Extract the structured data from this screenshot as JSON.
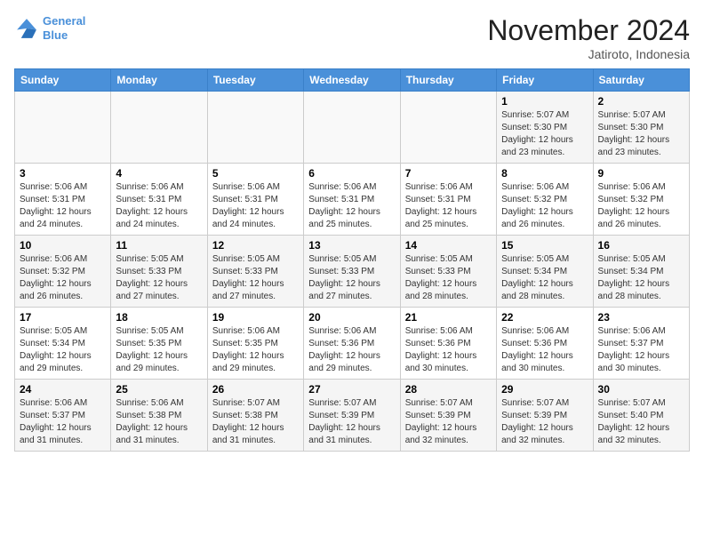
{
  "header": {
    "logo_line1": "General",
    "logo_line2": "Blue",
    "month_title": "November 2024",
    "location": "Jatiroto, Indonesia"
  },
  "weekdays": [
    "Sunday",
    "Monday",
    "Tuesday",
    "Wednesday",
    "Thursday",
    "Friday",
    "Saturday"
  ],
  "weeks": [
    [
      {
        "day": "",
        "info": ""
      },
      {
        "day": "",
        "info": ""
      },
      {
        "day": "",
        "info": ""
      },
      {
        "day": "",
        "info": ""
      },
      {
        "day": "",
        "info": ""
      },
      {
        "day": "1",
        "info": "Sunrise: 5:07 AM\nSunset: 5:30 PM\nDaylight: 12 hours and 23 minutes."
      },
      {
        "day": "2",
        "info": "Sunrise: 5:07 AM\nSunset: 5:30 PM\nDaylight: 12 hours and 23 minutes."
      }
    ],
    [
      {
        "day": "3",
        "info": "Sunrise: 5:06 AM\nSunset: 5:31 PM\nDaylight: 12 hours and 24 minutes."
      },
      {
        "day": "4",
        "info": "Sunrise: 5:06 AM\nSunset: 5:31 PM\nDaylight: 12 hours and 24 minutes."
      },
      {
        "day": "5",
        "info": "Sunrise: 5:06 AM\nSunset: 5:31 PM\nDaylight: 12 hours and 24 minutes."
      },
      {
        "day": "6",
        "info": "Sunrise: 5:06 AM\nSunset: 5:31 PM\nDaylight: 12 hours and 25 minutes."
      },
      {
        "day": "7",
        "info": "Sunrise: 5:06 AM\nSunset: 5:31 PM\nDaylight: 12 hours and 25 minutes."
      },
      {
        "day": "8",
        "info": "Sunrise: 5:06 AM\nSunset: 5:32 PM\nDaylight: 12 hours and 26 minutes."
      },
      {
        "day": "9",
        "info": "Sunrise: 5:06 AM\nSunset: 5:32 PM\nDaylight: 12 hours and 26 minutes."
      }
    ],
    [
      {
        "day": "10",
        "info": "Sunrise: 5:06 AM\nSunset: 5:32 PM\nDaylight: 12 hours and 26 minutes."
      },
      {
        "day": "11",
        "info": "Sunrise: 5:05 AM\nSunset: 5:33 PM\nDaylight: 12 hours and 27 minutes."
      },
      {
        "day": "12",
        "info": "Sunrise: 5:05 AM\nSunset: 5:33 PM\nDaylight: 12 hours and 27 minutes."
      },
      {
        "day": "13",
        "info": "Sunrise: 5:05 AM\nSunset: 5:33 PM\nDaylight: 12 hours and 27 minutes."
      },
      {
        "day": "14",
        "info": "Sunrise: 5:05 AM\nSunset: 5:33 PM\nDaylight: 12 hours and 28 minutes."
      },
      {
        "day": "15",
        "info": "Sunrise: 5:05 AM\nSunset: 5:34 PM\nDaylight: 12 hours and 28 minutes."
      },
      {
        "day": "16",
        "info": "Sunrise: 5:05 AM\nSunset: 5:34 PM\nDaylight: 12 hours and 28 minutes."
      }
    ],
    [
      {
        "day": "17",
        "info": "Sunrise: 5:05 AM\nSunset: 5:34 PM\nDaylight: 12 hours and 29 minutes."
      },
      {
        "day": "18",
        "info": "Sunrise: 5:05 AM\nSunset: 5:35 PM\nDaylight: 12 hours and 29 minutes."
      },
      {
        "day": "19",
        "info": "Sunrise: 5:06 AM\nSunset: 5:35 PM\nDaylight: 12 hours and 29 minutes."
      },
      {
        "day": "20",
        "info": "Sunrise: 5:06 AM\nSunset: 5:36 PM\nDaylight: 12 hours and 29 minutes."
      },
      {
        "day": "21",
        "info": "Sunrise: 5:06 AM\nSunset: 5:36 PM\nDaylight: 12 hours and 30 minutes."
      },
      {
        "day": "22",
        "info": "Sunrise: 5:06 AM\nSunset: 5:36 PM\nDaylight: 12 hours and 30 minutes."
      },
      {
        "day": "23",
        "info": "Sunrise: 5:06 AM\nSunset: 5:37 PM\nDaylight: 12 hours and 30 minutes."
      }
    ],
    [
      {
        "day": "24",
        "info": "Sunrise: 5:06 AM\nSunset: 5:37 PM\nDaylight: 12 hours and 31 minutes."
      },
      {
        "day": "25",
        "info": "Sunrise: 5:06 AM\nSunset: 5:38 PM\nDaylight: 12 hours and 31 minutes."
      },
      {
        "day": "26",
        "info": "Sunrise: 5:07 AM\nSunset: 5:38 PM\nDaylight: 12 hours and 31 minutes."
      },
      {
        "day": "27",
        "info": "Sunrise: 5:07 AM\nSunset: 5:39 PM\nDaylight: 12 hours and 31 minutes."
      },
      {
        "day": "28",
        "info": "Sunrise: 5:07 AM\nSunset: 5:39 PM\nDaylight: 12 hours and 32 minutes."
      },
      {
        "day": "29",
        "info": "Sunrise: 5:07 AM\nSunset: 5:39 PM\nDaylight: 12 hours and 32 minutes."
      },
      {
        "day": "30",
        "info": "Sunrise: 5:07 AM\nSunset: 5:40 PM\nDaylight: 12 hours and 32 minutes."
      }
    ]
  ]
}
